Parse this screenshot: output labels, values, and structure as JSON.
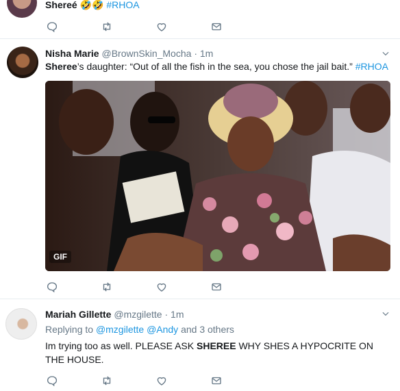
{
  "tweet1": {
    "name": "Shereé",
    "emoji": "🤣🤣",
    "hashtag": "#RHOA"
  },
  "tweet2": {
    "name": "Nisha Marie",
    "handle": "@BrownSkin_Mocha",
    "time": "· 1m",
    "text_bold": "Sheree",
    "text_rest": "’s daughter: “Out of all the fish in the sea, you chose the jail bait.” ",
    "hashtag": "#RHOA",
    "gif_badge": "GIF"
  },
  "tweet3": {
    "name": "Mariah Gillette",
    "handle": "@mzgilette",
    "time": "· 1m",
    "replying_prefix": "Replying to ",
    "reply_user1": "@mzgilette",
    "reply_user2": "@Andy",
    "reply_suffix": " and 3 others",
    "text_part1": "Im trying too as well. PLEASE ASK ",
    "text_bold": "SHEREE",
    "text_part2": " WHY SHES A HYPOCRITE ON THE HOUSE."
  },
  "icons": [
    "reply-icon",
    "retweet-icon",
    "like-icon",
    "message-icon",
    "chevron-down-icon"
  ],
  "colors": {
    "link": "#1b95e0",
    "muted": "#657786",
    "border": "#e6ecf0"
  }
}
